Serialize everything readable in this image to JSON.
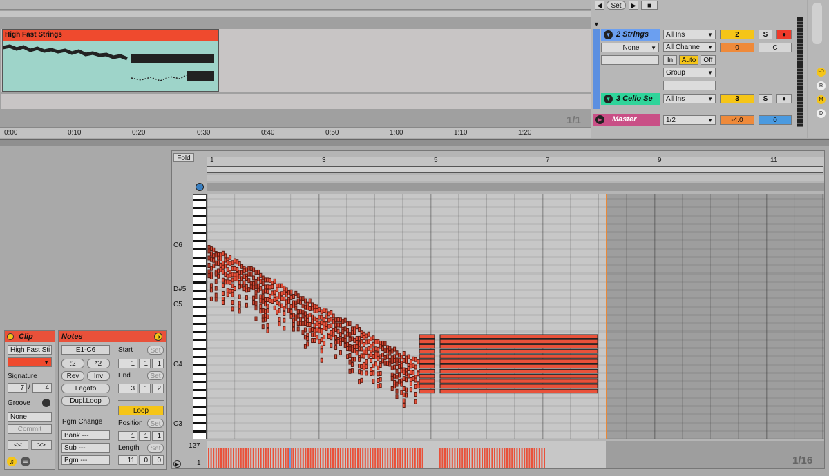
{
  "arrangement": {
    "clip_name": "High Fast Strings",
    "zoom_ratio": "1/1",
    "time_ticks": [
      "0:00",
      "0:10",
      "0:20",
      "0:30",
      "0:40",
      "0:50",
      "1:00",
      "1:10",
      "1:20"
    ],
    "set_label": "Set"
  },
  "mixer": {
    "tracks": [
      {
        "name": "2 Strings",
        "color": "#6b9ff0",
        "input": "All Ins",
        "channel": "All Channe",
        "monitor": [
          "In",
          "Auto",
          "Off"
        ],
        "output": "Group",
        "number": "2",
        "solo": "S",
        "volume": "0",
        "pan": "C",
        "input_left": "None"
      },
      {
        "name": "3 Cello Se",
        "color": "#2fd49a",
        "input": "All Ins",
        "number": "3",
        "solo": "S"
      },
      {
        "name": "Master",
        "color": "#c94f86",
        "output": "1/2",
        "volume": "-4.0",
        "pan": "0"
      }
    ],
    "side_buttons": [
      "I-O",
      "R",
      "M",
      "D"
    ]
  },
  "clip_panel": {
    "header": "Clip",
    "name": "High Fast Sti",
    "signature_label": "Signature",
    "sig_num": "7",
    "sig_sep": "/",
    "sig_den": "4",
    "groove_label": "Groove",
    "groove_value": "None",
    "commit": "Commit",
    "nav_left": "<<",
    "nav_right": ">>"
  },
  "notes_panel": {
    "header": "Notes",
    "range": "E1-C6",
    "half": ":2",
    "double": "*2",
    "rev": "Rev",
    "inv": "Inv",
    "legato": "Legato",
    "dupl": "Dupl.Loop",
    "pgm_change": "Pgm Change",
    "bank": "Bank ---",
    "sub": "Sub ---",
    "pgm": "Pgm ---",
    "start_label": "Start",
    "start": [
      "1",
      "1",
      "1"
    ],
    "end_label": "End",
    "end": [
      "3",
      "1",
      "2"
    ],
    "loop": "Loop",
    "position_label": "Position",
    "position": [
      "1",
      "1",
      "1"
    ],
    "length_label": "Length",
    "length": [
      "11",
      "0",
      "0"
    ],
    "set": "Set"
  },
  "editor": {
    "fold": "Fold",
    "bar_ticks": [
      "1",
      "3",
      "5",
      "7",
      "9",
      "11"
    ],
    "pitch_labels": [
      "C6",
      "D#5",
      "C5",
      "C4",
      "C3"
    ],
    "velocity_max": "127",
    "velocity_min": "1",
    "grid": "1/16",
    "note_color": "#e9513a"
  }
}
